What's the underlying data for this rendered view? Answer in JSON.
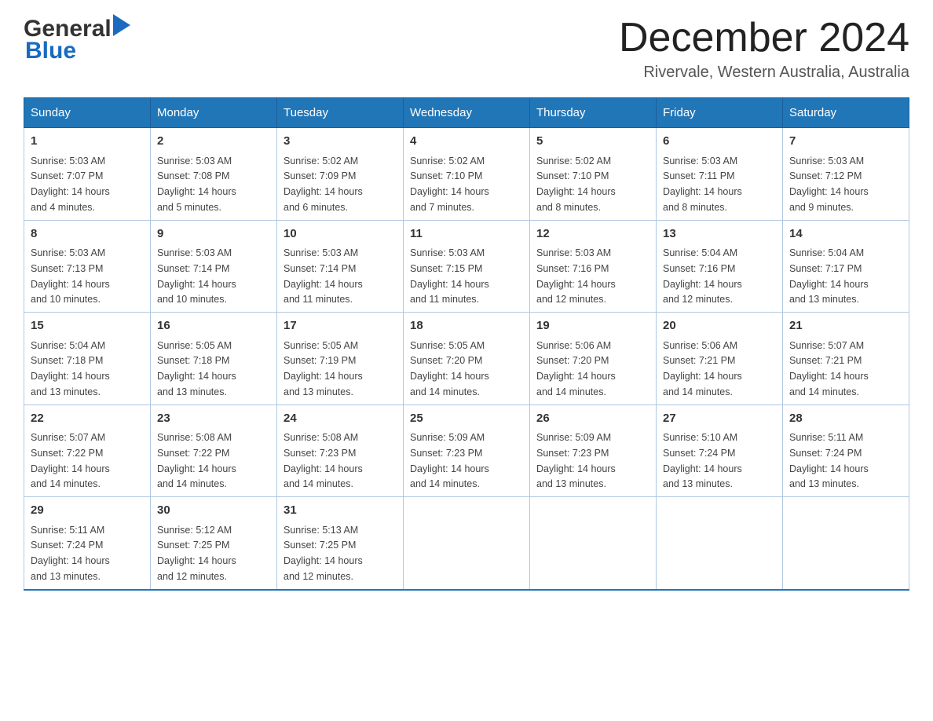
{
  "header": {
    "logo_general": "General",
    "logo_blue": "Blue",
    "month_title": "December 2024",
    "location": "Rivervale, Western Australia, Australia"
  },
  "days_of_week": [
    "Sunday",
    "Monday",
    "Tuesday",
    "Wednesday",
    "Thursday",
    "Friday",
    "Saturday"
  ],
  "weeks": [
    [
      {
        "day": "1",
        "sunrise": "5:03 AM",
        "sunset": "7:07 PM",
        "daylight": "14 hours and 4 minutes."
      },
      {
        "day": "2",
        "sunrise": "5:03 AM",
        "sunset": "7:08 PM",
        "daylight": "14 hours and 5 minutes."
      },
      {
        "day": "3",
        "sunrise": "5:02 AM",
        "sunset": "7:09 PM",
        "daylight": "14 hours and 6 minutes."
      },
      {
        "day": "4",
        "sunrise": "5:02 AM",
        "sunset": "7:10 PM",
        "daylight": "14 hours and 7 minutes."
      },
      {
        "day": "5",
        "sunrise": "5:02 AM",
        "sunset": "7:10 PM",
        "daylight": "14 hours and 8 minutes."
      },
      {
        "day": "6",
        "sunrise": "5:03 AM",
        "sunset": "7:11 PM",
        "daylight": "14 hours and 8 minutes."
      },
      {
        "day": "7",
        "sunrise": "5:03 AM",
        "sunset": "7:12 PM",
        "daylight": "14 hours and 9 minutes."
      }
    ],
    [
      {
        "day": "8",
        "sunrise": "5:03 AM",
        "sunset": "7:13 PM",
        "daylight": "14 hours and 10 minutes."
      },
      {
        "day": "9",
        "sunrise": "5:03 AM",
        "sunset": "7:14 PM",
        "daylight": "14 hours and 10 minutes."
      },
      {
        "day": "10",
        "sunrise": "5:03 AM",
        "sunset": "7:14 PM",
        "daylight": "14 hours and 11 minutes."
      },
      {
        "day": "11",
        "sunrise": "5:03 AM",
        "sunset": "7:15 PM",
        "daylight": "14 hours and 11 minutes."
      },
      {
        "day": "12",
        "sunrise": "5:03 AM",
        "sunset": "7:16 PM",
        "daylight": "14 hours and 12 minutes."
      },
      {
        "day": "13",
        "sunrise": "5:04 AM",
        "sunset": "7:16 PM",
        "daylight": "14 hours and 12 minutes."
      },
      {
        "day": "14",
        "sunrise": "5:04 AM",
        "sunset": "7:17 PM",
        "daylight": "14 hours and 13 minutes."
      }
    ],
    [
      {
        "day": "15",
        "sunrise": "5:04 AM",
        "sunset": "7:18 PM",
        "daylight": "14 hours and 13 minutes."
      },
      {
        "day": "16",
        "sunrise": "5:05 AM",
        "sunset": "7:18 PM",
        "daylight": "14 hours and 13 minutes."
      },
      {
        "day": "17",
        "sunrise": "5:05 AM",
        "sunset": "7:19 PM",
        "daylight": "14 hours and 13 minutes."
      },
      {
        "day": "18",
        "sunrise": "5:05 AM",
        "sunset": "7:20 PM",
        "daylight": "14 hours and 14 minutes."
      },
      {
        "day": "19",
        "sunrise": "5:06 AM",
        "sunset": "7:20 PM",
        "daylight": "14 hours and 14 minutes."
      },
      {
        "day": "20",
        "sunrise": "5:06 AM",
        "sunset": "7:21 PM",
        "daylight": "14 hours and 14 minutes."
      },
      {
        "day": "21",
        "sunrise": "5:07 AM",
        "sunset": "7:21 PM",
        "daylight": "14 hours and 14 minutes."
      }
    ],
    [
      {
        "day": "22",
        "sunrise": "5:07 AM",
        "sunset": "7:22 PM",
        "daylight": "14 hours and 14 minutes."
      },
      {
        "day": "23",
        "sunrise": "5:08 AM",
        "sunset": "7:22 PM",
        "daylight": "14 hours and 14 minutes."
      },
      {
        "day": "24",
        "sunrise": "5:08 AM",
        "sunset": "7:23 PM",
        "daylight": "14 hours and 14 minutes."
      },
      {
        "day": "25",
        "sunrise": "5:09 AM",
        "sunset": "7:23 PM",
        "daylight": "14 hours and 14 minutes."
      },
      {
        "day": "26",
        "sunrise": "5:09 AM",
        "sunset": "7:23 PM",
        "daylight": "14 hours and 13 minutes."
      },
      {
        "day": "27",
        "sunrise": "5:10 AM",
        "sunset": "7:24 PM",
        "daylight": "14 hours and 13 minutes."
      },
      {
        "day": "28",
        "sunrise": "5:11 AM",
        "sunset": "7:24 PM",
        "daylight": "14 hours and 13 minutes."
      }
    ],
    [
      {
        "day": "29",
        "sunrise": "5:11 AM",
        "sunset": "7:24 PM",
        "daylight": "14 hours and 13 minutes."
      },
      {
        "day": "30",
        "sunrise": "5:12 AM",
        "sunset": "7:25 PM",
        "daylight": "14 hours and 12 minutes."
      },
      {
        "day": "31",
        "sunrise": "5:13 AM",
        "sunset": "7:25 PM",
        "daylight": "14 hours and 12 minutes."
      },
      null,
      null,
      null,
      null
    ]
  ],
  "labels": {
    "sunrise": "Sunrise:",
    "sunset": "Sunset:",
    "daylight": "Daylight:"
  },
  "colors": {
    "header_bg": "#2176b8",
    "border": "#b0c8e0"
  }
}
